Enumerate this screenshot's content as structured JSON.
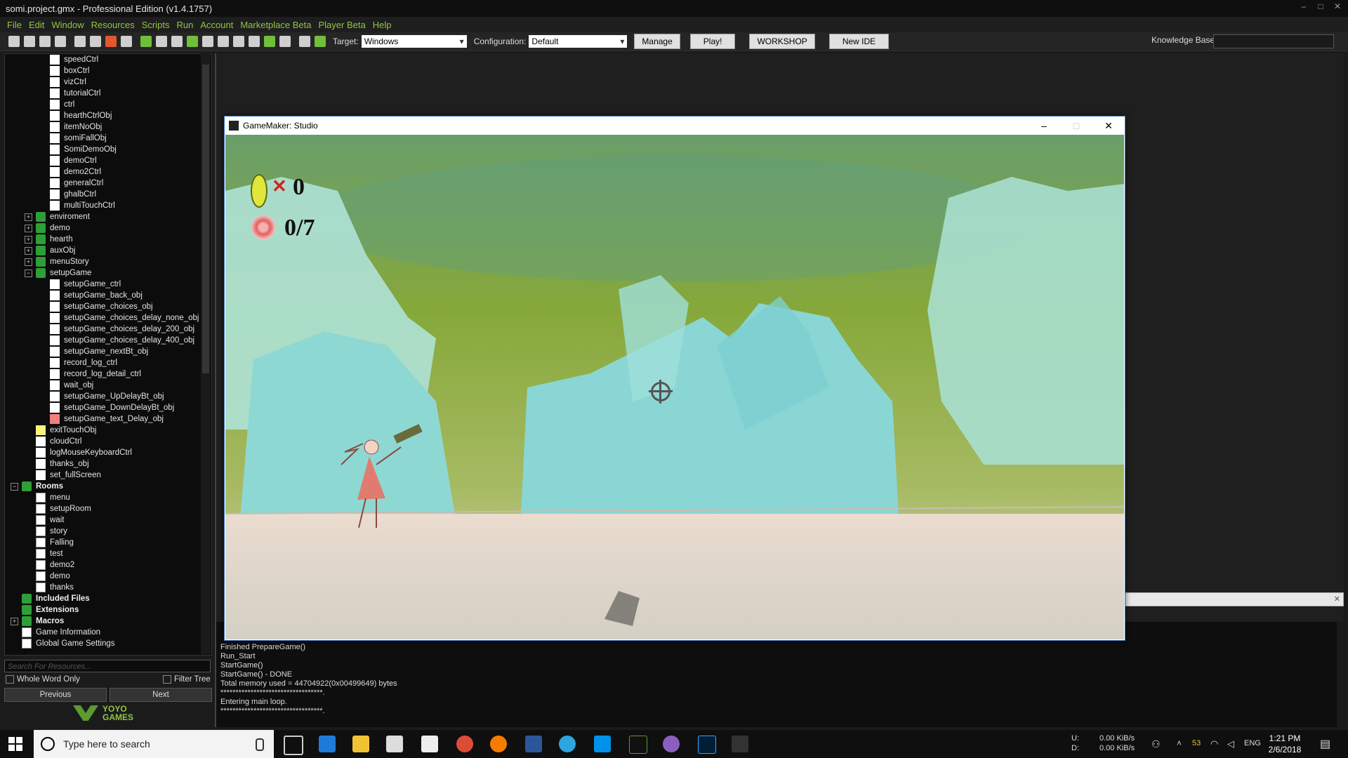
{
  "window": {
    "title": "somi.project.gmx  -  Professional Edition (v1.4.1757)"
  },
  "menu": [
    "File",
    "Edit",
    "Window",
    "Resources",
    "Scripts",
    "Run",
    "Account",
    "Marketplace Beta",
    "Player Beta",
    "Help"
  ],
  "toolbar": {
    "target_label": "Target:",
    "target_value": "Windows",
    "config_label": "Configuration:",
    "config_value": "Default",
    "manage": "Manage",
    "play": "Play!",
    "workshop": "WORKSHOP",
    "new_ide": "New IDE",
    "kb_label": "Knowledge Base:"
  },
  "tree": {
    "items": [
      {
        "label": "speedCtrl",
        "icon": "white"
      },
      {
        "label": "boxCtrl",
        "icon": "white"
      },
      {
        "label": "vizCtrl",
        "icon": "white"
      },
      {
        "label": "tutorialCtrl",
        "icon": "white"
      },
      {
        "label": "ctrl",
        "icon": "white"
      },
      {
        "label": "hearthCtrlObj",
        "icon": "white"
      },
      {
        "label": "itemNoObj",
        "icon": "white"
      },
      {
        "label": "somiFallObj",
        "icon": "white"
      },
      {
        "label": "SomiDemoObj",
        "icon": "white"
      },
      {
        "label": "demoCtrl",
        "icon": "white"
      },
      {
        "label": "demo2Ctrl",
        "icon": "white"
      },
      {
        "label": "generalCtrl",
        "icon": "white"
      },
      {
        "label": "ghalbCtrl",
        "icon": "white"
      },
      {
        "label": "multiTouchCtrl",
        "icon": "white"
      }
    ],
    "folders1": [
      "enviroment",
      "demo",
      "hearth",
      "auxObj",
      "menuStory",
      "setupGame"
    ],
    "setup_items": [
      "setupGame_ctrl",
      "setupGame_back_obj",
      "setupGame_choices_obj",
      "setupGame_choices_delay_none_obj",
      "setupGame_choices_delay_200_obj",
      "setupGame_choices_delay_400_obj",
      "setupGame_nextBt_obj",
      "record_log_ctrl",
      "record_log_detail_ctrl",
      "wait_obj",
      "setupGame_UpDelayBt_obj",
      "setupGame_DownDelayBt_obj",
      "setupGame_text_Delay_obj"
    ],
    "after_items": [
      "exitTouchObj",
      "cloudCtrl",
      "logMouseKeyboardCtrl",
      "thanks_obj",
      "set_fullScreen"
    ],
    "rooms_label": "Rooms",
    "rooms": [
      "menu",
      "setupRoom",
      "wait",
      "story",
      "Falling",
      "test",
      "demo2",
      "demo",
      "thanks"
    ],
    "included_files": "Included Files",
    "extensions": "Extensions",
    "macros": "Macros",
    "game_info": "Game Information",
    "global_settings": "Global Game Settings"
  },
  "search": {
    "placeholder": "Search For Resources...",
    "whole_word": "Whole Word Only",
    "filter_tree": "Filter Tree",
    "previous": "Previous",
    "next": "Next"
  },
  "brand": {
    "line1": "YOYO",
    "line2": "GAMES"
  },
  "gamewindow": {
    "title": "GameMaker: Studio",
    "coins": "0",
    "targets": "0/7"
  },
  "console": {
    "lines": [
      "Finished PrepareGame()",
      "Run_Start",
      "StartGame()",
      "StartGame() - DONE",
      "Total memory used = 44704922(0x00499649) bytes",
      "**********************************.",
      "Entering main loop.",
      "**********************************."
    ]
  },
  "taskbar": {
    "search_placeholder": "Type here to search",
    "net_u": "U:",
    "net_d": "D:",
    "net_up": "0.00 KiB/s",
    "net_down": "0.00 KiB/s",
    "battery": "53",
    "lang": "ENG",
    "time": "1:21 PM",
    "date": "2/6/2018"
  },
  "colors": {
    "accent_green": "#8fc641",
    "sky_top": "#9bbf3a",
    "ice": "#8fd8d4",
    "ground": "#e7ddcf"
  }
}
